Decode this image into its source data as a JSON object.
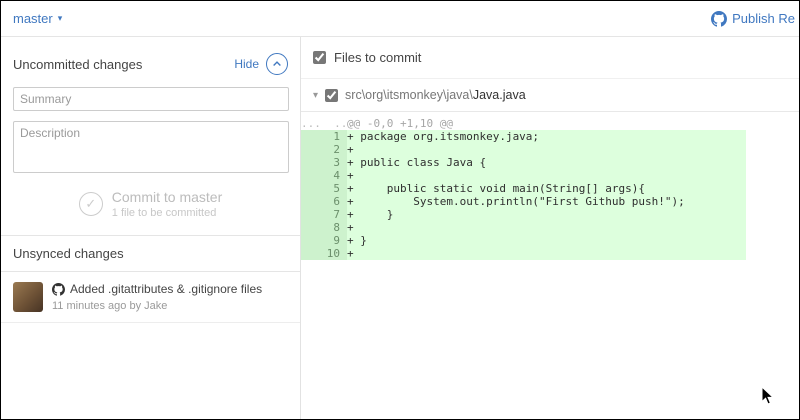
{
  "topbar": {
    "branch": "master",
    "publish": "Publish Re"
  },
  "sidebar": {
    "uncommitted_title": "Uncommitted changes",
    "hide_label": "Hide",
    "summary_placeholder": "Summary",
    "description_placeholder": "Description",
    "commit": {
      "button": "Commit to master",
      "subtitle": "1 file to be committed"
    },
    "unsynced_title": "Unsynced changes",
    "history": [
      {
        "message": "Added .gitattributes & .gitignore files",
        "meta": "11 minutes ago by Jake"
      }
    ]
  },
  "main": {
    "files_header": "Files to commit",
    "file": {
      "path_prefix": "src\\org\\itsmonkey\\java\\",
      "name": "Java.java"
    },
    "diff": {
      "gutter_dots": "...  ...",
      "hunk": "@@ -0,0 +1,10 @@",
      "lines": [
        {
          "num": "1",
          "text": "+ package org.itsmonkey.java;"
        },
        {
          "num": "2",
          "text": "+"
        },
        {
          "num": "3",
          "text": "+ public class Java {"
        },
        {
          "num": "4",
          "text": "+"
        },
        {
          "num": "5",
          "text": "+     public static void main(String[] args){"
        },
        {
          "num": "6",
          "text": "+         System.out.println(\"First Github push!\");"
        },
        {
          "num": "7",
          "text": "+     }"
        },
        {
          "num": "8",
          "text": "+"
        },
        {
          "num": "9",
          "text": "+ }"
        },
        {
          "num": "10",
          "text": "+"
        }
      ]
    }
  },
  "colors": {
    "accent_blue": "#4078c0",
    "diff_added_bg": "#ddffdd",
    "diff_added_gutter_bg": "#cdf2cd"
  }
}
